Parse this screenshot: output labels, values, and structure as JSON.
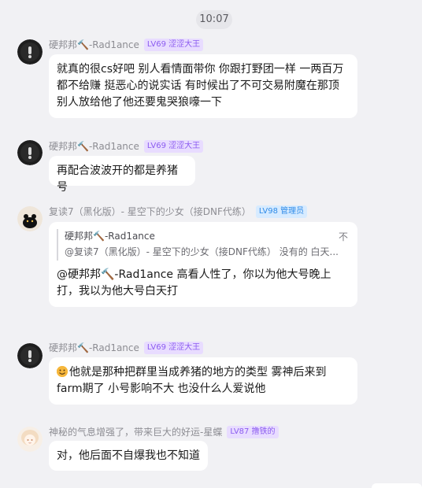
{
  "timestamp": "10:07",
  "messages": [
    {
      "name": "硬邦邦🔨-Rad1ance",
      "badge": "LV69 涩涩大王",
      "badge_color": "#8c5cf0",
      "text": "就真的很cs好吧 别人看情面带你 你跟打野团一样 一两百万都不给赚 挺恶心的说实话 有时候出了不可交易附魔在那顶 别人放给他了他还要鬼哭狼嚎一下"
    },
    {
      "name": "硬邦邦🔨-Rad1ance",
      "badge": "LV69 涩涩大王",
      "badge_color": "#8c5cf0",
      "text": "再配合波波开的都是养猪号"
    },
    {
      "name": "复读7（黑化版）- 星空下的少女（接DNF代练）",
      "badge": "LV98 管理员",
      "badge_color": "#2f8be8",
      "quote_name": "硬邦邦🔨-Rad1ance",
      "quote_tag": "不",
      "quote_text": "@复读7（黑化版）- 星空下的少女（接DNF代练） 没有的 白天...",
      "text": "@硬邦邦🔨-Rad1ance 高看人性了，你以为他大号晚上打，我以为他大号白天打"
    },
    {
      "name": "硬邦邦🔨-Rad1ance",
      "badge": "LV69 涩涩大王",
      "badge_color": "#8c5cf0",
      "emoji": "grinning-emoji",
      "text": "他就是那种把群里当成养猪的地方的类型 雾神后来到farm期了 小号影响不大 也没什么人爱说他"
    },
    {
      "name": "神秘的气息增强了，带来巨大的好运-星蝶",
      "badge": "LV87 撸铁的",
      "badge_color": "#8c5cf0",
      "text": "对，他后面不自爆我也不知道"
    }
  ]
}
